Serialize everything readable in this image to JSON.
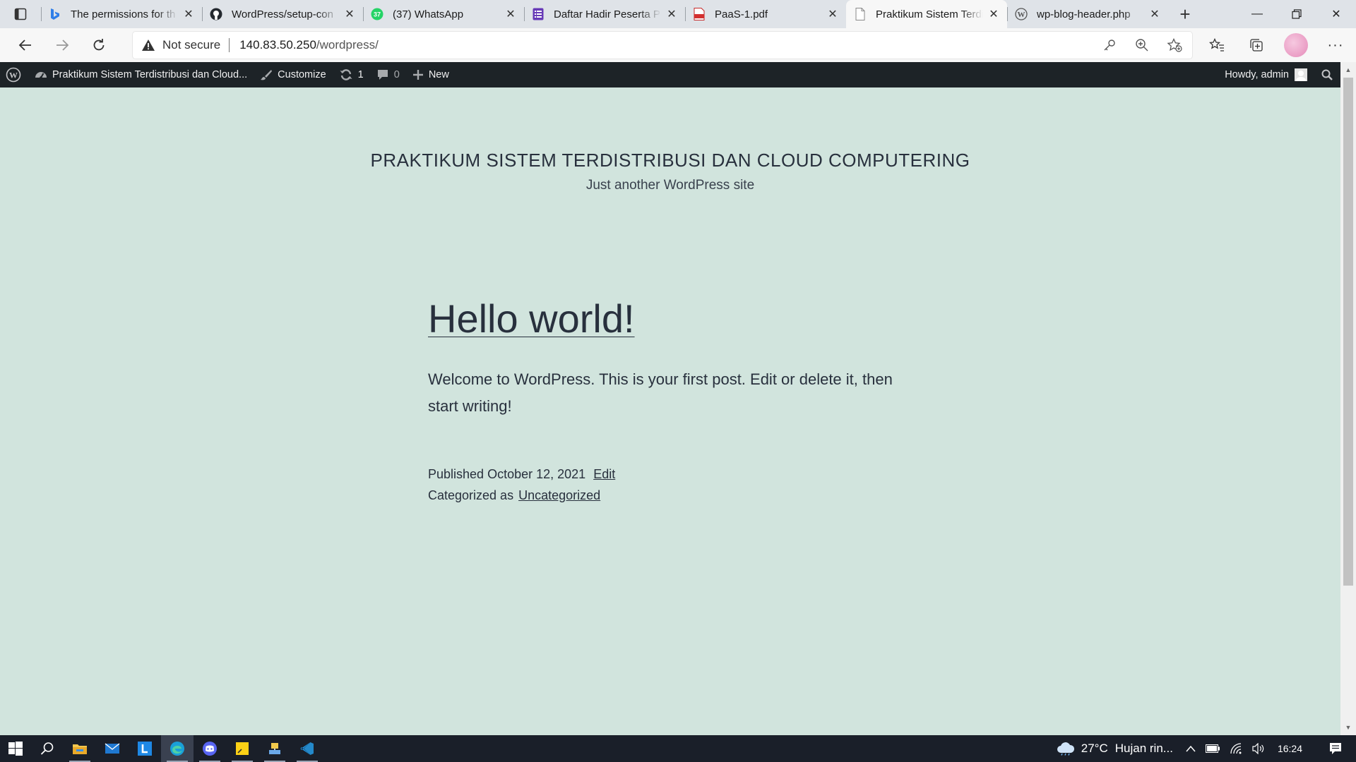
{
  "browser": {
    "tabs": [
      {
        "title": "The permissions for th",
        "favicon": "bing-icon",
        "active": false
      },
      {
        "title": "WordPress/setup-con",
        "favicon": "github-icon",
        "active": false
      },
      {
        "title": "(37) WhatsApp",
        "favicon": "whatsapp-icon",
        "active": false,
        "badge": "37"
      },
      {
        "title": "Daftar Hadir Peserta P",
        "favicon": "forms-icon",
        "active": false
      },
      {
        "title": "PaaS-1.pdf",
        "favicon": "pdf-icon",
        "active": false
      },
      {
        "title": "Praktikum Sistem Terdi",
        "favicon": "page-icon",
        "active": true
      },
      {
        "title": "wp-blog-header.php",
        "favicon": "wordpress-icon",
        "active": false
      }
    ],
    "address": {
      "security_label": "Not secure",
      "host": "140.83.50.250",
      "path": "/wordpress/"
    }
  },
  "adminbar": {
    "site_name": "Praktikum Sistem Terdistribusi dan Cloud...",
    "customize": "Customize",
    "updates_count": "1",
    "comments_count": "0",
    "new_label": "New",
    "howdy": "Howdy, admin"
  },
  "site": {
    "title": "PRAKTIKUM SISTEM TERDISTRIBUSI DAN CLOUD COMPUTERING",
    "description": "Just another WordPress site"
  },
  "post": {
    "title": "Hello world!",
    "body": "Welcome to WordPress. This is your first post. Edit or delete it, then start writing!",
    "published_prefix": "Published",
    "published_date": "October 12, 2021",
    "edit_label": "Edit",
    "categorized_prefix": "Categorized as",
    "category": "Uncategorized"
  },
  "taskbar": {
    "weather_temp": "27°C",
    "weather_desc": "Hujan rin...",
    "time": "16:24"
  },
  "colors": {
    "page_background": "#d1e4dd",
    "admin_bar": "#1d2327",
    "text": "#28303d"
  }
}
